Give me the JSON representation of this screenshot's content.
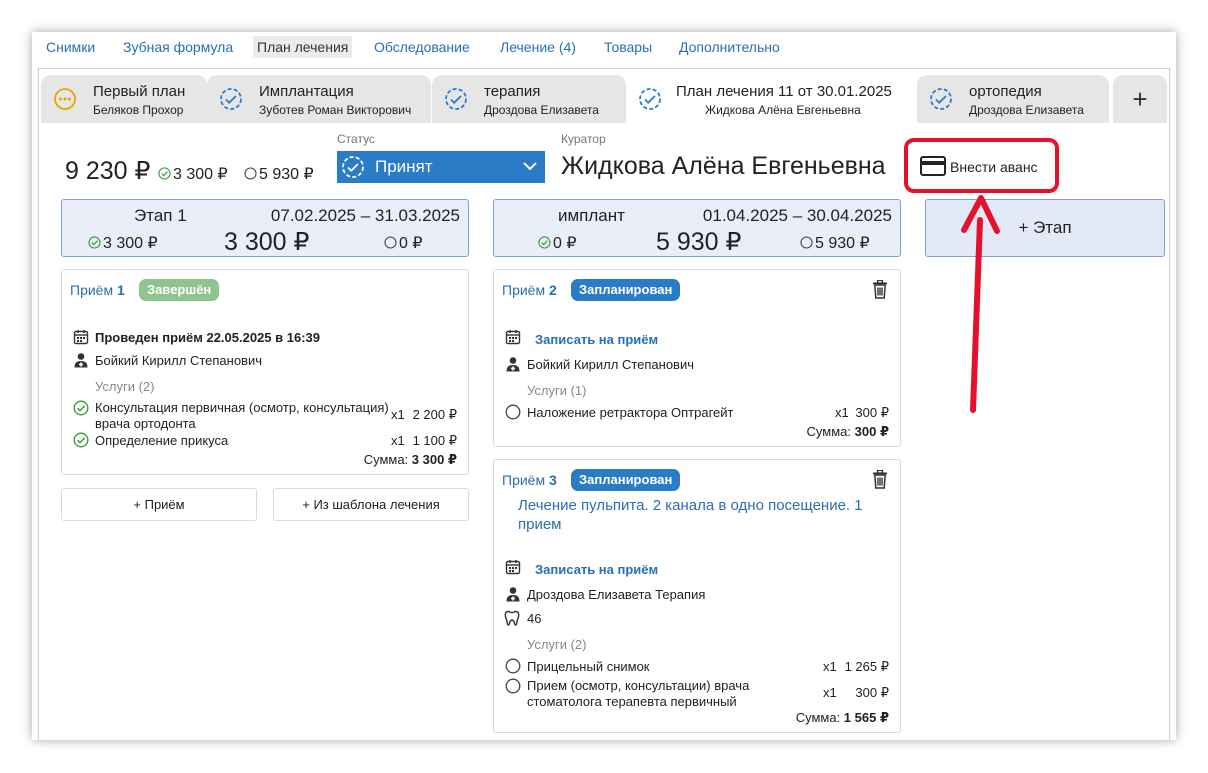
{
  "nav": {
    "items": [
      "Снимки",
      "Зубная формула",
      "План лечения",
      "Обследование",
      "Лечение (4)",
      "Товары",
      "Дополнительно"
    ],
    "active_index": 2
  },
  "tabs": [
    {
      "title": "Первый план",
      "subtitle": "Беляков Прохор",
      "icon": "dots-circle-icon",
      "active": false
    },
    {
      "title": "Имплантация",
      "subtitle": "Зуботев Роман Викторович",
      "icon": "dashed-check-circle-icon",
      "active": false
    },
    {
      "title": "терапия",
      "subtitle": "Дроздова Елизавета",
      "icon": "dashed-check-circle-icon",
      "active": false
    },
    {
      "title": "План лечения 11 от 30.01.2025",
      "subtitle": "Жидкова Алёна Евгеньевна",
      "icon": "dashed-check-circle-icon",
      "active": true
    },
    {
      "title": "ортопедия",
      "subtitle": "Дроздова Елизавета",
      "icon": "dashed-check-circle-icon",
      "active": false
    }
  ],
  "tab_add_label": "+",
  "summary": {
    "total": "9 230 ₽",
    "paid": "3 300 ₽",
    "rest": "5 930 ₽"
  },
  "status": {
    "label": "Статус",
    "value": "Принят"
  },
  "curator": {
    "label": "Куратор",
    "name": "Жидкова Алёна Евгеньевна"
  },
  "advance_button": "Внести аванс",
  "stages": [
    {
      "name": "Этап 1",
      "dates": "07.02.2025 – 31.03.2025",
      "paid": "3 300 ₽",
      "total": "3 300 ₽",
      "rest": "0 ₽"
    },
    {
      "name": "имплант",
      "dates": "01.04.2025 – 30.04.2025",
      "paid": "0 ₽",
      "total": "5 930 ₽",
      "rest": "5 930 ₽"
    }
  ],
  "add_stage_label": "+ Этап",
  "visit1": {
    "title_prefix": "Приём",
    "number": "1",
    "status": "Завершён",
    "date_line": "Проведен приём 22.05.2025 в 16:39",
    "doctor": "Бойкий Кирилл Степанович",
    "services_label": "Услуги (2)",
    "services": [
      {
        "name": "Консультация первичная (осмотр, консультация) врача ортодонта",
        "qty": "x1",
        "price": "2 200 ₽",
        "done": true
      },
      {
        "name": "Определение прикуса",
        "qty": "x1",
        "price": "1 100 ₽",
        "done": true
      }
    ],
    "sum_label": "Сумма:",
    "sum": "3 300 ₽"
  },
  "stage1_buttons": {
    "add_visit": "+ Приём",
    "from_template": "+ Из шаблона лечения"
  },
  "visit2": {
    "title_prefix": "Приём",
    "number": "2",
    "status": "Запланирован",
    "book_link": "Записать на приём",
    "doctor": "Бойкий Кирилл Степанович",
    "services_label": "Услуги (1)",
    "services": [
      {
        "name": "Наложение ретрактора Оптрагейт",
        "qty": "x1",
        "price": "300 ₽",
        "done": false
      }
    ],
    "sum_label": "Сумма:",
    "sum": "300 ₽"
  },
  "visit3": {
    "title_prefix": "Приём",
    "number": "3",
    "status": "Запланирован",
    "description": "Лечение пульпита. 2 канала в одно посещение. 1 прием",
    "book_link": "Записать на приём",
    "doctor": "Дроздова Елизавета Терапия",
    "tooth": "46",
    "services_label": "Услуги (2)",
    "services": [
      {
        "name": "Прицельный снимок",
        "qty": "x1",
        "price": "1 265 ₽",
        "done": false
      },
      {
        "name": "Прием (осмотр, консультации) врача стоматолога терапевта первичный",
        "qty": "x1",
        "price": "300 ₽",
        "done": false
      }
    ],
    "sum_label": "Сумма:",
    "sum": "1 565 ₽"
  },
  "colors": {
    "link": "#2a6fb3",
    "accent": "#2a7cc7",
    "done_badge": "#8fc48f",
    "highlight": "#e5102b",
    "stage_bg": "#e9eef8"
  }
}
